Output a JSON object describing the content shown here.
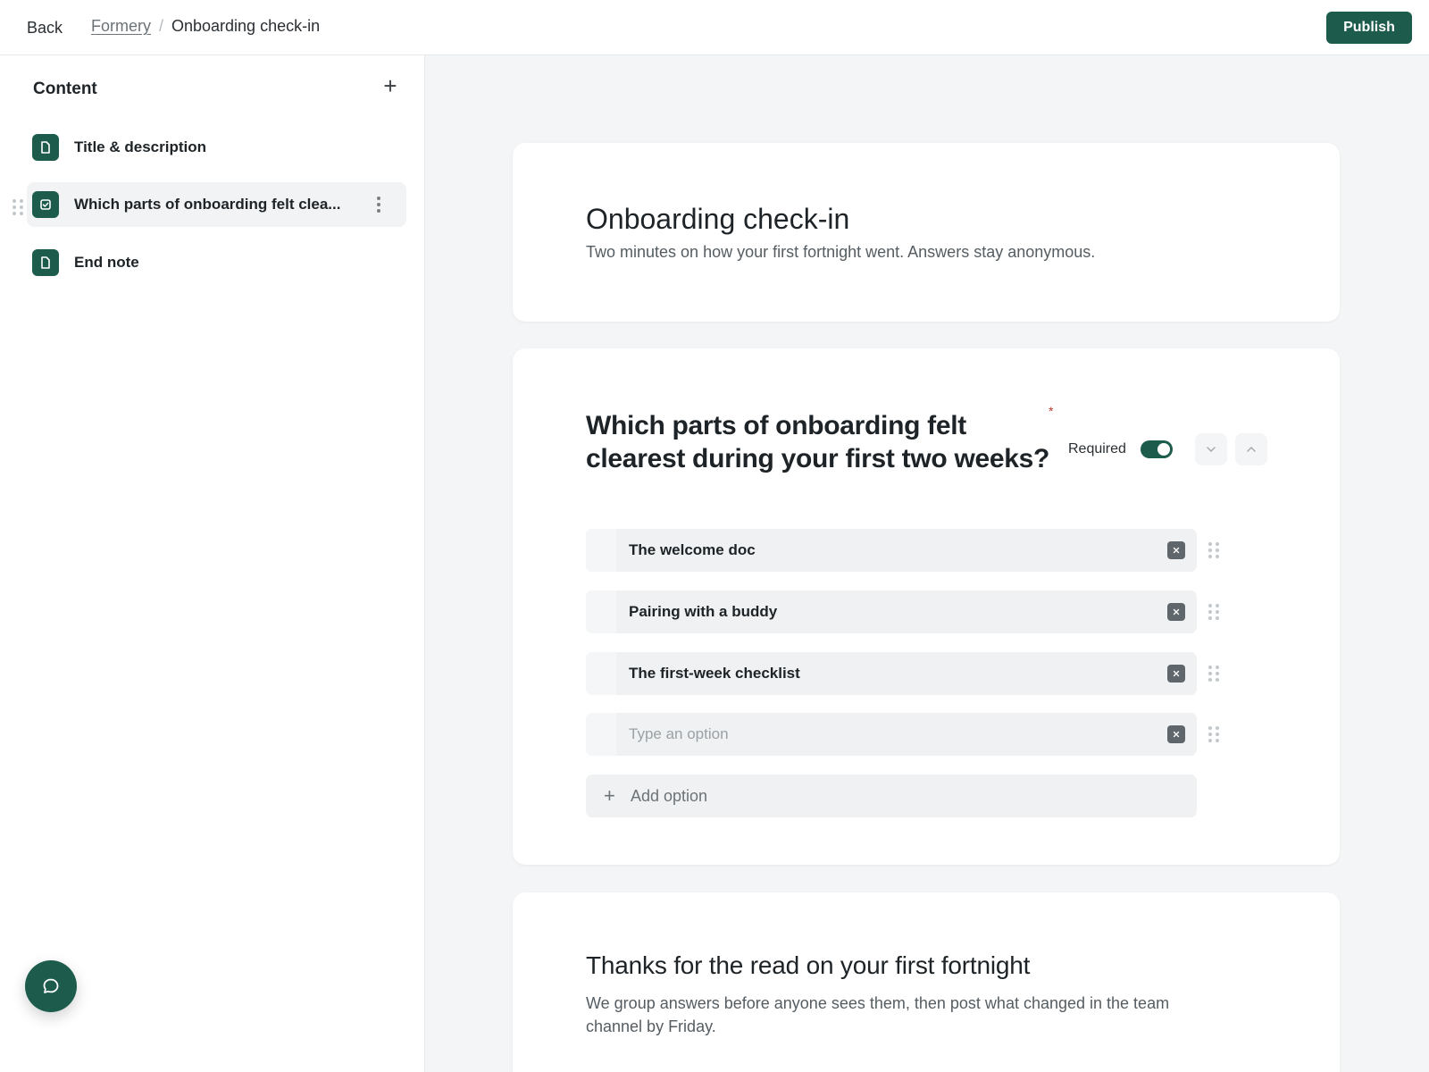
{
  "header": {
    "back_label": "Back",
    "breadcrumb_root": "Formery",
    "breadcrumb_separator": "/",
    "breadcrumb_current": "Onboarding check-in",
    "publish_label": "Publish"
  },
  "sidebar": {
    "title": "Content",
    "items": [
      {
        "label": "Title & description",
        "icon": "document-icon"
      },
      {
        "label": "Which parts of onboarding felt clea...",
        "icon": "checkbox-icon",
        "active": true
      },
      {
        "label": "End note",
        "icon": "document-icon"
      }
    ]
  },
  "form": {
    "intro": {
      "title": "Onboarding check-in",
      "description": "Two minutes on how your first fortnight went. Answers stay anonymous."
    },
    "question": {
      "title": "Which parts of onboarding felt clearest during your first two weeks?",
      "required_marker": "*",
      "required_label": "Required",
      "required": true,
      "options": [
        {
          "label": "The welcome doc"
        },
        {
          "label": "Pairing with a buddy"
        },
        {
          "label": "The first-week checklist"
        }
      ],
      "new_option_placeholder": "Type an option",
      "add_option_label": "Add option"
    },
    "end_note": {
      "title": "Thanks for the read on your first fortnight",
      "description": "We group answers before anyone sees them, then post what changed in the team channel by Friday."
    }
  },
  "colors": {
    "accent": "#1d5c4d",
    "required_star": "#c0392b"
  }
}
